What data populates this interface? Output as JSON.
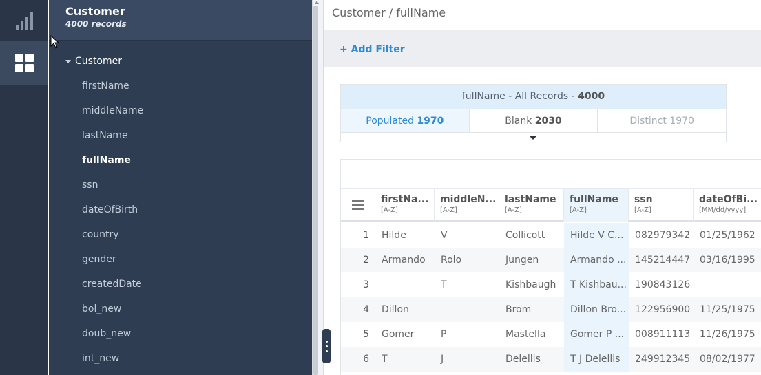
{
  "rail": {
    "items": [
      {
        "icon": "bar-chart-icon"
      },
      {
        "icon": "grid-icon",
        "active": true
      }
    ]
  },
  "sidebar": {
    "title": "Customer",
    "subtitle": "4000 records",
    "root_label": "Customer",
    "fields": [
      "firstName",
      "middleName",
      "lastName",
      "fullName",
      "ssn",
      "dateOfBirth",
      "country",
      "gender",
      "createdDate",
      "bol_new",
      "doub_new",
      "int_new"
    ],
    "active_field": "fullName"
  },
  "breadcrumb": "Customer / fullName",
  "filter": {
    "label": "+ Add Filter"
  },
  "stats": {
    "header_prefix": "fullName - All Records - ",
    "header_count": "4000",
    "populated_label": "Populated ",
    "populated_count": "1970",
    "blank_label": "Blank ",
    "blank_count": "2030",
    "distinct_label": "Distinct ",
    "distinct_count": "1970"
  },
  "table": {
    "columns": [
      {
        "name": "firstNa...",
        "sub": "[A-Z]"
      },
      {
        "name": "middleN...",
        "sub": "[A-Z]"
      },
      {
        "name": "lastName",
        "sub": "[A-Z]"
      },
      {
        "name": "fullName",
        "sub": "[A-Z]"
      },
      {
        "name": "ssn",
        "sub": "[A-Z]"
      },
      {
        "name": "dateOfBi...",
        "sub": "[MM/dd/yyyy]"
      }
    ],
    "rows": [
      {
        "n": "1",
        "cells": [
          "Hilde",
          "V",
          "Collicott",
          "Hilde V C...",
          "082979342",
          "01/25/1962"
        ]
      },
      {
        "n": "2",
        "cells": [
          "Armando",
          "Rolo",
          "Jungen",
          "Armando ...",
          "145214447",
          "03/16/1995"
        ]
      },
      {
        "n": "3",
        "cells": [
          "",
          "T",
          "Kishbaugh",
          "T Kishbau...",
          "190843126",
          ""
        ]
      },
      {
        "n": "4",
        "cells": [
          "Dillon",
          "",
          "Brom",
          "Dillon Bro...",
          "122956900",
          "11/25/1975"
        ]
      },
      {
        "n": "5",
        "cells": [
          "Gomer",
          "P",
          "Mastella",
          "Gomer P ...",
          "008911113",
          "11/26/1975"
        ]
      },
      {
        "n": "6",
        "cells": [
          "T",
          "J",
          "Delellis",
          "T J Delellis",
          "249912345",
          "08/02/1977"
        ]
      }
    ]
  },
  "colors": {
    "accent": "#2e8bd3",
    "sidebar_bg": "#2f3d53",
    "rail_bg": "#2a3547",
    "highlight": "#e9f4fc"
  }
}
